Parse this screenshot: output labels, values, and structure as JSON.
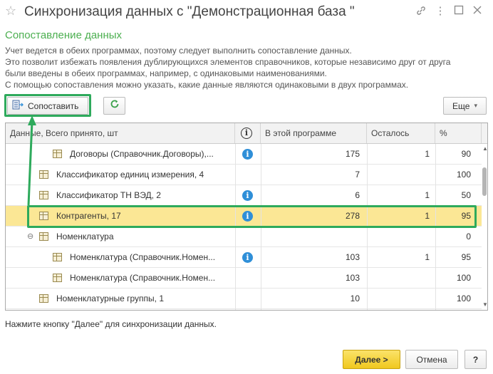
{
  "window": {
    "title": "Синхронизация данных с \"Демонстрационная база \"",
    "star_icon": "star-icon",
    "link_icon": "link-icon",
    "menu_icon": "more-vertical-icon",
    "maximize_icon": "maximize-icon",
    "close_icon": "close-icon"
  },
  "section": {
    "title": "Сопоставление данных",
    "description": [
      "Учет ведется в обеих программах, поэтому следует выполнить сопоставление данных.",
      "Это позволит избежать появления дублирующихся элементов справочников, которые независимо друг от друга",
      "были введены в обеих программах, например, с одинаковыми наименованиями.",
      "С помощью сопоставления можно указать, какие данные являются одинаковыми в двух программах."
    ]
  },
  "toolbar": {
    "match_label": "Сопоставить",
    "refresh_icon": "refresh-icon",
    "more_label": "Еще",
    "more_chevron": "▾"
  },
  "table": {
    "columns": [
      "Данные, Всего принято, шт",
      "i",
      "В этой программе",
      "Осталось",
      "%"
    ],
    "rows": [
      {
        "name": "Договоры (Справочник.Договоры),...",
        "level": 2,
        "info": true,
        "in_program": "175",
        "remaining": "1",
        "percent": "90",
        "selected": false
      },
      {
        "name": "Классификатор единиц измерения, 4",
        "level": 1,
        "info": false,
        "in_program": "7",
        "remaining": "",
        "percent": "100",
        "selected": false
      },
      {
        "name": "Классификатор ТН ВЭД, 2",
        "level": 1,
        "info": true,
        "in_program": "6",
        "remaining": "1",
        "percent": "50",
        "selected": false
      },
      {
        "name": "Контрагенты, 17",
        "level": 1,
        "info": true,
        "in_program": "278",
        "remaining": "1",
        "percent": "95",
        "selected": true
      },
      {
        "name": "Номенклатура",
        "level": 1,
        "info": false,
        "in_program": "",
        "remaining": "",
        "percent": "0",
        "selected": false,
        "group": true
      },
      {
        "name": "Номенклатура (Справочник.Номен...",
        "level": 2,
        "info": true,
        "in_program": "103",
        "remaining": "1",
        "percent": "95",
        "selected": false
      },
      {
        "name": "Номенклатура (Справочник.Номен...",
        "level": 2,
        "info": false,
        "in_program": "103",
        "remaining": "",
        "percent": "100",
        "selected": false
      },
      {
        "name": "Номенклатурные группы, 1",
        "level": 1,
        "info": false,
        "in_program": "10",
        "remaining": "",
        "percent": "100",
        "selected": false
      }
    ]
  },
  "footer": {
    "note": "Нажмите кнопку \"Далее\" для синхронизации данных.",
    "next_label": "Далее >",
    "cancel_label": "Отмена",
    "help_label": "?"
  },
  "colors": {
    "accent": "#4caf50",
    "highlight_frame": "#2eaa5c",
    "selected_row": "#fbe795",
    "info": "#2f8fd8",
    "primary_button": "#f0c81e"
  }
}
